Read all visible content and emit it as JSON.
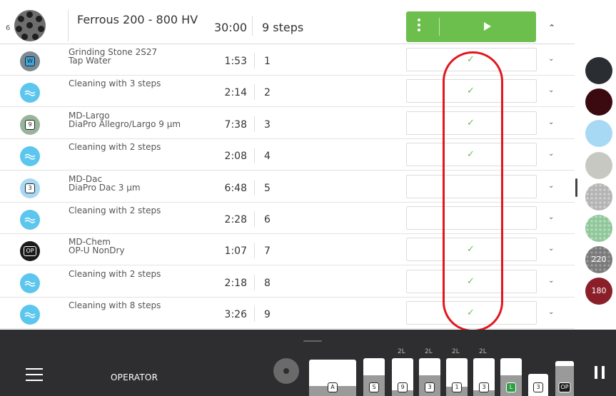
{
  "method": {
    "holder_number": "6",
    "title": "Ferrous 200 - 800 HV",
    "total_time": "30:00",
    "steps_count": "9 steps"
  },
  "steps": [
    {
      "name1": "Grinding Stone 2S27",
      "name2": "Tap Water",
      "time": "1:53",
      "num": "1",
      "checked": true,
      "icon": "grinding-stone-icon",
      "badge": "W",
      "color": "#7c8a93"
    },
    {
      "name1": "Cleaning with 3 steps",
      "name2": "",
      "time": "2:14",
      "num": "2",
      "checked": true,
      "icon": "cleaning-icon",
      "badge": "",
      "color": "#5cc6ee"
    },
    {
      "name1": "MD-Largo",
      "name2": "DiaPro Allegro/Largo 9 µm",
      "time": "7:38",
      "num": "3",
      "checked": true,
      "icon": "md-largo-icon",
      "badge": "9",
      "color": "#98b59a"
    },
    {
      "name1": "Cleaning with 2 steps",
      "name2": "",
      "time": "2:08",
      "num": "4",
      "checked": true,
      "icon": "cleaning-icon",
      "badge": "",
      "color": "#5cc6ee"
    },
    {
      "name1": "MD-Dac",
      "name2": "DiaPro Dac 3 µm",
      "time": "6:48",
      "num": "5",
      "checked": false,
      "icon": "md-dac-icon",
      "badge": "3",
      "color": "#a8d9f4"
    },
    {
      "name1": "Cleaning with 2 steps",
      "name2": "",
      "time": "2:28",
      "num": "6",
      "checked": false,
      "icon": "cleaning-icon",
      "badge": "",
      "color": "#5cc6ee"
    },
    {
      "name1": "MD-Chem",
      "name2": "OP-U NonDry",
      "time": "1:07",
      "num": "7",
      "checked": true,
      "icon": "md-chem-icon",
      "badge": "OP",
      "color": "#1b1b1b"
    },
    {
      "name1": "Cleaning with 2 steps",
      "name2": "",
      "time": "2:18",
      "num": "8",
      "checked": true,
      "icon": "cleaning-icon",
      "badge": "",
      "color": "#5cc6ee"
    },
    {
      "name1": "Cleaning with 8 steps",
      "name2": "",
      "time": "3:26",
      "num": "9",
      "checked": true,
      "icon": "cleaning-icon",
      "badge": "",
      "color": "#5cc6ee"
    }
  ],
  "palette": [
    {
      "color": "#2a2e33",
      "label": ""
    },
    {
      "color": "#3a0a10",
      "label": ""
    },
    {
      "color": "#a8d9f4",
      "label": ""
    },
    {
      "color": "#c8c8c2",
      "label": ""
    },
    {
      "color": "#b4b4b4",
      "label": ""
    },
    {
      "color": "#8fc79a",
      "label": ""
    },
    {
      "color": "#7a7a7a",
      "label": "220"
    },
    {
      "color": "#8a1f2a",
      "label": "180"
    }
  ],
  "bottom": {
    "operator_label": "OPERATOR",
    "bottles": [
      {
        "label": "A",
        "volume": "",
        "fill": 0.28
      },
      {
        "label": "S",
        "volume": "",
        "fill": 0.55
      },
      {
        "label": "9",
        "volume": "2L",
        "fill": 0.15
      },
      {
        "label": "3",
        "volume": "2L",
        "fill": 0.55
      },
      {
        "label": "1",
        "volume": "2L",
        "fill": 0.25
      },
      {
        "label": "3",
        "volume": "2L",
        "fill": 0.15
      },
      {
        "label": "L",
        "volume": "",
        "fill": 0.55
      },
      {
        "label": "3",
        "volume": "",
        "fill": 0.0
      },
      {
        "label": "OP",
        "volume": "",
        "fill": 0.85
      }
    ]
  },
  "colors": {
    "accent_green": "#6cbf4c",
    "highlight_red": "#e2171e",
    "bottom_bar": "#2e2e30"
  }
}
